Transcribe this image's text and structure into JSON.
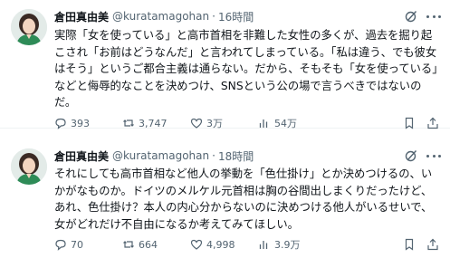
{
  "tweets": [
    {
      "name": "倉田真由美",
      "handle": "@kuratamagohan",
      "time": "16時間",
      "text": "実際「女を使っている」と高市首相を非難した女性の多くが、過去を掘り起こされ「お前はどうなんだ」と言われてしまっている。「私は違う、でも彼女はそう」というご都合主義は通らない。だから、そもそも「女を使っている」などと侮辱的なことを決めつけ、SNSという公の場で言うべきではないのだ。",
      "replies": "393",
      "reposts": "3,747",
      "likes": "3万",
      "views": "54万"
    },
    {
      "name": "倉田真由美",
      "handle": "@kuratamagohan",
      "time": "18時間",
      "text": "それにしても高市首相など他人の挙動を「色仕掛け」とか決めつけるの、いかがなものか。ドイツのメルケル元首相は胸の谷間出しまくりだったけど、あれ、色仕掛け？本人の内心分からないのに決めつける他人がいるせいで、女がどれだけ不自由になるか考えてみてほしい。",
      "replies": "70",
      "reposts": "664",
      "likes": "4,998",
      "views": "3.9万"
    }
  ],
  "icons": {
    "reply": "reply-icon",
    "repost": "repost-icon",
    "like": "heart-icon",
    "views": "views-icon",
    "bookmark": "bookmark-icon",
    "share": "share-icon",
    "grok": "grok-icon",
    "more": "more-icon"
  },
  "colors": {
    "text": "#0f1419",
    "muted": "#536471",
    "avatar_shirt": "#2e8b57"
  }
}
